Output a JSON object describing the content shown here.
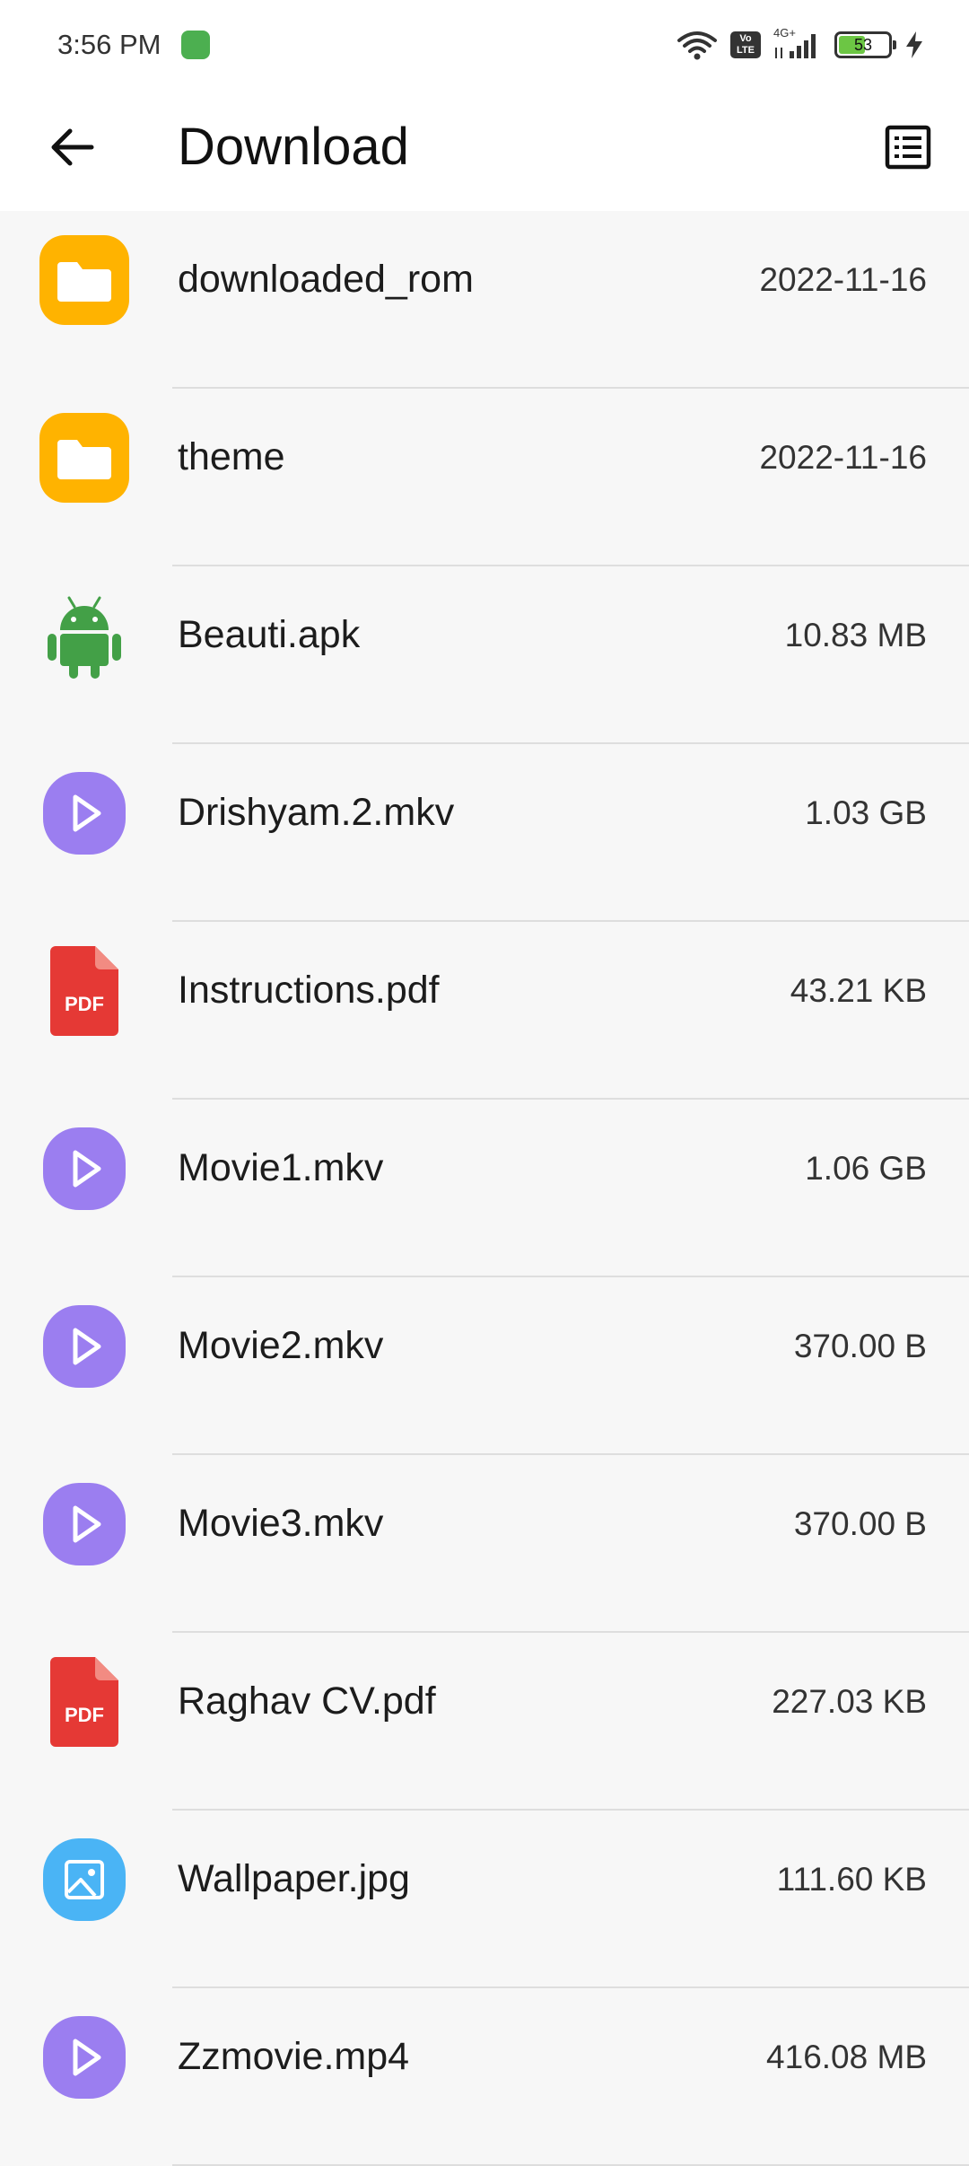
{
  "status_bar": {
    "time": "3:56 PM",
    "volte": "Vo LTE",
    "network": "4G+",
    "battery_percent": "53",
    "battery_level": 0.53
  },
  "header": {
    "title": "Download",
    "back_icon": "arrow-left-icon",
    "view_icon": "list-view-icon"
  },
  "colors": {
    "folder": "#FFB300",
    "apk": "#43A047",
    "video": "#9B7EF0",
    "pdf": "#E53935",
    "image": "#4AB4F5"
  },
  "files": [
    {
      "name": "downloaded_rom",
      "meta": "2022-11-16",
      "type": "folder"
    },
    {
      "name": "theme",
      "meta": "2022-11-16",
      "type": "folder"
    },
    {
      "name": "Beauti.apk",
      "meta": "10.83 MB",
      "type": "apk"
    },
    {
      "name": "Drishyam.2.mkv",
      "meta": "1.03 GB",
      "type": "video"
    },
    {
      "name": "Instructions.pdf",
      "meta": "43.21 KB",
      "type": "pdf"
    },
    {
      "name": "Movie1.mkv",
      "meta": "1.06 GB",
      "type": "video"
    },
    {
      "name": "Movie2.mkv",
      "meta": "370.00 B",
      "type": "video"
    },
    {
      "name": "Movie3.mkv",
      "meta": "370.00 B",
      "type": "video"
    },
    {
      "name": "Raghav CV.pdf",
      "meta": "227.03 KB",
      "type": "pdf"
    },
    {
      "name": "Wallpaper.jpg",
      "meta": "111.60 KB",
      "type": "image"
    },
    {
      "name": "Zzmovie.mp4",
      "meta": "416.08 MB",
      "type": "video"
    }
  ]
}
